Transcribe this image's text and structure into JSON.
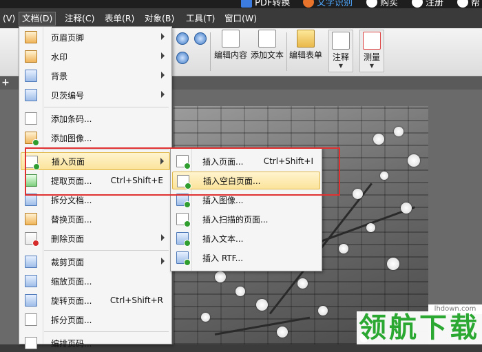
{
  "titlebar": {
    "items": [
      "PDF转换",
      "文字识别",
      "购买",
      "注册",
      "帮"
    ]
  },
  "menubar": {
    "items": [
      "(V)",
      "文档(D)",
      "注释(C)",
      "表单(R)",
      "对象(B)",
      "工具(T)",
      "窗口(W)"
    ]
  },
  "toolbar": {
    "edit_content": "编辑内容",
    "add_text": "添加文本",
    "edit_form": "编辑表单",
    "comment": "注释",
    "measure": "测量"
  },
  "document_menu": {
    "items": [
      {
        "label": "页眉页脚",
        "shortcut": "",
        "submenu": true
      },
      {
        "label": "水印",
        "shortcut": "",
        "submenu": true
      },
      {
        "label": "背景",
        "shortcut": "",
        "submenu": true
      },
      {
        "label": "贝茨编号",
        "shortcut": "",
        "submenu": true
      },
      {
        "label": "添加条码...",
        "shortcut": "",
        "submenu": false
      },
      {
        "label": "添加图像...",
        "shortcut": "",
        "submenu": false
      },
      {
        "label": "插入页面",
        "shortcut": "",
        "submenu": true
      },
      {
        "label": "提取页面...",
        "shortcut": "Ctrl+Shift+E",
        "submenu": false
      },
      {
        "label": "拆分文档...",
        "shortcut": "",
        "submenu": false
      },
      {
        "label": "替换页面...",
        "shortcut": "",
        "submenu": false
      },
      {
        "label": "删除页面",
        "shortcut": "",
        "submenu": true
      },
      {
        "label": "裁剪页面",
        "shortcut": "",
        "submenu": true
      },
      {
        "label": "缩放页面...",
        "shortcut": "",
        "submenu": false
      },
      {
        "label": "旋转页面...",
        "shortcut": "Ctrl+Shift+R",
        "submenu": false
      },
      {
        "label": "拆分页面...",
        "shortcut": "",
        "submenu": false
      },
      {
        "label": "编排页码...",
        "shortcut": "",
        "submenu": false
      }
    ]
  },
  "insert_submenu": {
    "items": [
      {
        "label": "插入页面...",
        "shortcut": "Ctrl+Shift+I",
        "icon_caption": ""
      },
      {
        "label": "插入空白页面...",
        "shortcut": "",
        "icon_caption": ""
      },
      {
        "label": "插入图像...",
        "shortcut": "",
        "icon_caption": "BMP"
      },
      {
        "label": "插入扫描的页面...",
        "shortcut": "",
        "icon_caption": ""
      },
      {
        "label": "插入文本...",
        "shortcut": "",
        "icon_caption": "TXT"
      },
      {
        "label": "插入 RTF...",
        "shortcut": "",
        "icon_caption": "RTF"
      }
    ]
  },
  "watermark": {
    "url": "lhdown.com",
    "text": "领航下载"
  },
  "colors": {
    "highlight_border": "#e13030",
    "hover_fill": "#fbe39a",
    "watermark_green": "#2aa832"
  }
}
